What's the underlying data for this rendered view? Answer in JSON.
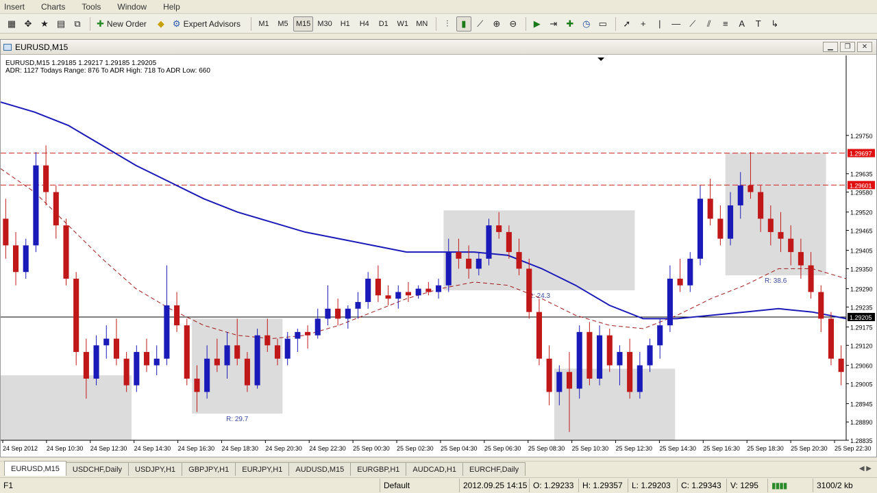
{
  "menu": [
    "Insert",
    "Charts",
    "Tools",
    "Window",
    "Help"
  ],
  "toolbar": {
    "new_order": "New Order",
    "expert_advisors": "Expert Advisors",
    "timeframes": [
      "M1",
      "M5",
      "M15",
      "M30",
      "H1",
      "H4",
      "D1",
      "W1",
      "MN"
    ],
    "active_timeframe": "M15"
  },
  "window": {
    "title": "EURUSD,M15",
    "info_line1": "EURUSD,M15  1.29185 1.29217 1.29185 1.29205",
    "info_line2": "ADR: 1127  Todays Range: 876  To ADR High: 718  To ADR Low: 660"
  },
  "chart_data": {
    "type": "candlestick",
    "symbol": "EURUSD",
    "timeframe": "M15",
    "ylim": [
      1.28835,
      1.2999
    ],
    "y_ticks": [
      "1.29750",
      "1.29635",
      "1.29580",
      "1.29520",
      "1.29465",
      "1.29405",
      "1.29350",
      "1.29290",
      "1.29235",
      "1.29175",
      "1.29120",
      "1.29060",
      "1.29005",
      "1.28945",
      "1.28890",
      "1.28835"
    ],
    "x_ticks": [
      "24 Sep 2012",
      "24 Sep 10:30",
      "24 Sep 12:30",
      "24 Sep 14:30",
      "24 Sep 16:30",
      "24 Sep 18:30",
      "24 Sep 20:30",
      "24 Sep 22:30",
      "25 Sep 00:30",
      "25 Sep 02:30",
      "25 Sep 04:30",
      "25 Sep 06:30",
      "25 Sep 08:30",
      "25 Sep 10:30",
      "25 Sep 12:30",
      "25 Sep 14:30",
      "25 Sep 16:30",
      "25 Sep 18:30",
      "25 Sep 20:30",
      "25 Sep 22:30"
    ],
    "price_labels": [
      {
        "value": 1.29697,
        "text": "1.29697",
        "color": "#e01010"
      },
      {
        "value": 1.29601,
        "text": "1.29601",
        "color": "#e01010"
      },
      {
        "value": 1.29205,
        "text": "1.29205",
        "color": "#000000"
      }
    ],
    "horizontal_lines": [
      {
        "value": 1.29697,
        "style": "dashed",
        "color": "#d02020"
      },
      {
        "value": 1.29601,
        "style": "dashed",
        "color": "#d02020"
      },
      {
        "value": 1.29205,
        "style": "solid",
        "color": "#000000"
      }
    ],
    "range_boxes": [
      {
        "label": "R: 29.7",
        "top": 1.292,
        "bottom": 1.28915
      },
      {
        "label": "R: 24.3",
        "top": 1.29525,
        "bottom": 1.29285
      },
      {
        "label": "R: 38.6",
        "top": 1.29697,
        "bottom": 1.2933
      },
      {
        "label": "",
        "top": 1.2903,
        "bottom": 1.28835
      },
      {
        "label": "",
        "top": 1.2905,
        "bottom": 1.28835
      }
    ],
    "series": [
      {
        "kind": "moving_average",
        "color": "#1a1ab8",
        "style": "solid",
        "values": [
          1.2985,
          1.2982,
          1.2978,
          1.2972,
          1.2966,
          1.2961,
          1.2956,
          1.2952,
          1.2949,
          1.2946,
          1.2944,
          1.2942,
          1.294,
          1.294,
          1.294,
          1.2939,
          1.2935,
          1.293,
          1.2924,
          1.292,
          1.292,
          1.2921,
          1.2922,
          1.2923,
          1.2922,
          1.292
        ]
      },
      {
        "kind": "moving_average",
        "color": "#a01818",
        "style": "dashed",
        "values": [
          1.2965,
          1.2958,
          1.2948,
          1.2938,
          1.2929,
          1.2923,
          1.2918,
          1.2915,
          1.2914,
          1.2915,
          1.2918,
          1.2922,
          1.2926,
          1.2929,
          1.2931,
          1.293,
          1.2926,
          1.2921,
          1.2918,
          1.2917,
          1.2921,
          1.2926,
          1.293,
          1.2935,
          1.2935,
          1.2932
        ]
      }
    ],
    "candles_ohlc": [
      [
        1.295,
        1.2956,
        1.2938,
        1.2942
      ],
      [
        1.2942,
        1.2946,
        1.293,
        1.2934
      ],
      [
        1.2934,
        1.2944,
        1.2932,
        1.2942
      ],
      [
        1.2942,
        1.297,
        1.294,
        1.2966
      ],
      [
        1.2966,
        1.2972,
        1.2954,
        1.2958
      ],
      [
        1.2958,
        1.296,
        1.2944,
        1.2948
      ],
      [
        1.2948,
        1.295,
        1.293,
        1.2932
      ],
      [
        1.2932,
        1.2934,
        1.2906,
        1.291
      ],
      [
        1.291,
        1.2914,
        1.2896,
        1.2902
      ],
      [
        1.2902,
        1.2915,
        1.29,
        1.2912
      ],
      [
        1.2912,
        1.2918,
        1.2908,
        1.2914
      ],
      [
        1.2914,
        1.292,
        1.2906,
        1.2908
      ],
      [
        1.2908,
        1.291,
        1.2898,
        1.29
      ],
      [
        1.29,
        1.2912,
        1.2898,
        1.291
      ],
      [
        1.291,
        1.2914,
        1.2904,
        1.2906
      ],
      [
        1.2906,
        1.2912,
        1.2903,
        1.2908
      ],
      [
        1.2908,
        1.2936,
        1.2906,
        1.2924
      ],
      [
        1.2924,
        1.2928,
        1.2916,
        1.2918
      ],
      [
        1.2918,
        1.292,
        1.29,
        1.2902
      ],
      [
        1.2902,
        1.2906,
        1.2892,
        1.2898
      ],
      [
        1.2898,
        1.2912,
        1.2896,
        1.2908
      ],
      [
        1.2908,
        1.2914,
        1.2904,
        1.2906
      ],
      [
        1.2906,
        1.2916,
        1.2902,
        1.2912
      ],
      [
        1.2912,
        1.292,
        1.2906,
        1.2908
      ],
      [
        1.2908,
        1.291,
        1.2898,
        1.29
      ],
      [
        1.29,
        1.2917,
        1.2899,
        1.2915
      ],
      [
        1.2915,
        1.292,
        1.291,
        1.2912
      ],
      [
        1.2912,
        1.2914,
        1.2906,
        1.2908
      ],
      [
        1.2908,
        1.2916,
        1.2906,
        1.2914
      ],
      [
        1.2914,
        1.2917,
        1.291,
        1.2916
      ],
      [
        1.2916,
        1.2918,
        1.2911,
        1.2915
      ],
      [
        1.2915,
        1.2923,
        1.2914,
        1.292
      ],
      [
        1.292,
        1.293,
        1.2918,
        1.2923
      ],
      [
        1.2923,
        1.2926,
        1.2918,
        1.292
      ],
      [
        1.292,
        1.2924,
        1.2917,
        1.2923
      ],
      [
        1.2923,
        1.2928,
        1.292,
        1.2925
      ],
      [
        1.2925,
        1.2934,
        1.2923,
        1.2932
      ],
      [
        1.2932,
        1.2936,
        1.2925,
        1.2927
      ],
      [
        1.2927,
        1.293,
        1.2924,
        1.2926
      ],
      [
        1.2926,
        1.293,
        1.2923,
        1.2928
      ],
      [
        1.2928,
        1.2931,
        1.2925,
        1.2927
      ],
      [
        1.2927,
        1.293,
        1.2926,
        1.2929
      ],
      [
        1.2929,
        1.2931,
        1.2927,
        1.2928
      ],
      [
        1.2928,
        1.2932,
        1.2926,
        1.293
      ],
      [
        1.293,
        1.2944,
        1.2928,
        1.294
      ],
      [
        1.294,
        1.2944,
        1.2935,
        1.2938
      ],
      [
        1.2938,
        1.2942,
        1.2932,
        1.2935
      ],
      [
        1.2935,
        1.294,
        1.2933,
        1.2938
      ],
      [
        1.2938,
        1.295,
        1.2936,
        1.2948
      ],
      [
        1.2948,
        1.2952,
        1.2944,
        1.2946
      ],
      [
        1.2946,
        1.2948,
        1.2938,
        1.294
      ],
      [
        1.294,
        1.2944,
        1.2933,
        1.2935
      ],
      [
        1.2935,
        1.2938,
        1.292,
        1.2922
      ],
      [
        1.2922,
        1.2926,
        1.2906,
        1.2908
      ],
      [
        1.2908,
        1.2912,
        1.2894,
        1.2898
      ],
      [
        1.2898,
        1.2906,
        1.2894,
        1.2904
      ],
      [
        1.2904,
        1.291,
        1.2886,
        1.2899
      ],
      [
        1.2899,
        1.2918,
        1.2896,
        1.2916
      ],
      [
        1.2916,
        1.2919,
        1.29,
        1.2902
      ],
      [
        1.2902,
        1.2918,
        1.29,
        1.2915
      ],
      [
        1.2915,
        1.2917,
        1.2904,
        1.2906
      ],
      [
        1.2906,
        1.2912,
        1.29,
        1.291
      ],
      [
        1.291,
        1.2914,
        1.2896,
        1.2898
      ],
      [
        1.2898,
        1.291,
        1.2896,
        1.2906
      ],
      [
        1.2906,
        1.2914,
        1.2904,
        1.2912
      ],
      [
        1.2912,
        1.292,
        1.2908,
        1.2918
      ],
      [
        1.2918,
        1.2936,
        1.2916,
        1.2932
      ],
      [
        1.2932,
        1.2938,
        1.2928,
        1.293
      ],
      [
        1.293,
        1.294,
        1.2928,
        1.2938
      ],
      [
        1.2938,
        1.296,
        1.2936,
        1.2956
      ],
      [
        1.2956,
        1.2962,
        1.2948,
        1.295
      ],
      [
        1.295,
        1.2954,
        1.2942,
        1.2944
      ],
      [
        1.2944,
        1.2958,
        1.2942,
        1.2954
      ],
      [
        1.2954,
        1.2964,
        1.295,
        1.296
      ],
      [
        1.296,
        1.297,
        1.2956,
        1.2958
      ],
      [
        1.2958,
        1.296,
        1.2946,
        1.295
      ],
      [
        1.295,
        1.2954,
        1.2942,
        1.2946
      ],
      [
        1.2946,
        1.2952,
        1.294,
        1.2944
      ],
      [
        1.2944,
        1.2948,
        1.2936,
        1.294
      ],
      [
        1.294,
        1.2944,
        1.2932,
        1.2936
      ],
      [
        1.2936,
        1.294,
        1.2926,
        1.2928
      ],
      [
        1.2928,
        1.293,
        1.2916,
        1.292
      ],
      [
        1.292,
        1.2922,
        1.2906,
        1.2908
      ],
      [
        1.2908,
        1.2912,
        1.29,
        1.2904
      ]
    ]
  },
  "tabs": [
    "EURUSD,M15",
    "USDCHF,Daily",
    "USDJPY,H1",
    "GBPJPY,H1",
    "EURJPY,H1",
    "AUDUSD,M15",
    "EURGBP,H1",
    "AUDCAD,H1",
    "EURCHF,Daily"
  ],
  "active_tab": "EURUSD,M15",
  "status": {
    "help": "F1",
    "profile": "Default",
    "datetime": "2012.09.25 14:15",
    "open": "O: 1.29233",
    "high": "H: 1.29357",
    "low": "L: 1.29203",
    "close": "C: 1.29343",
    "volume": "V: 1295",
    "traffic": "3100/2 kb"
  }
}
